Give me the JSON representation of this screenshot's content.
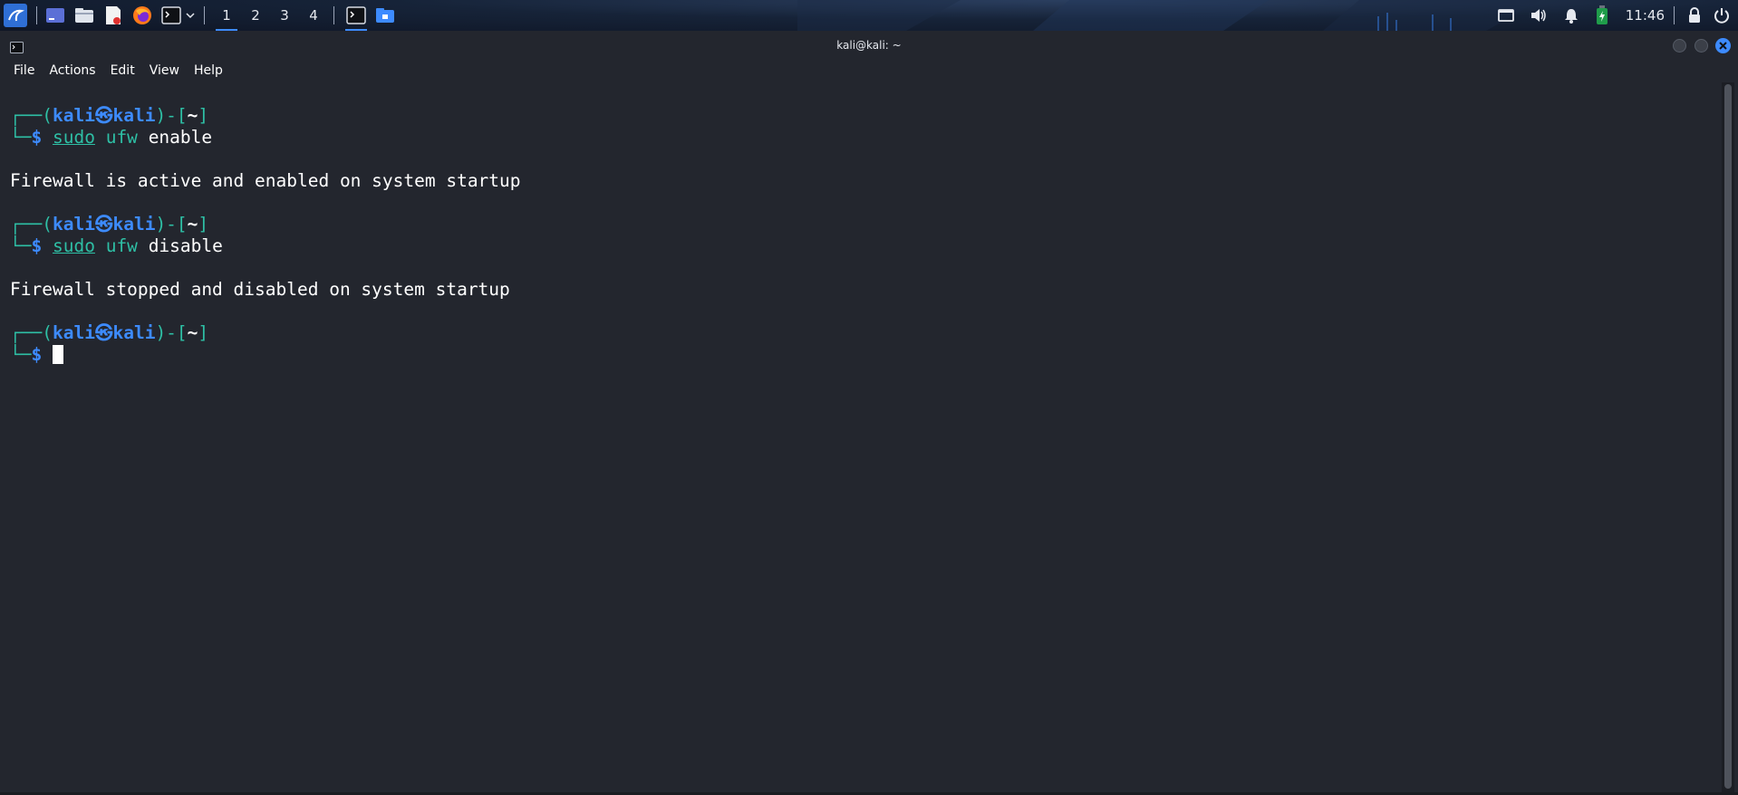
{
  "panel": {
    "workspaces": [
      "1",
      "2",
      "3",
      "4"
    ],
    "active_workspace": "1",
    "clock": "11:46",
    "icons": [
      "kali-menu-icon",
      "desktop-icon",
      "file-manager-icon",
      "text-editor-icon",
      "firefox-icon",
      "terminal-icon",
      "dropdown-icon",
      "terminal-task-icon",
      "file-manager-task-icon",
      "display-icon",
      "volume-icon",
      "notification-bell-icon",
      "battery-icon",
      "lock-icon",
      "power-icon"
    ]
  },
  "window": {
    "title": "kali@kali: ~",
    "menu": [
      "File",
      "Actions",
      "Edit",
      "View",
      "Help"
    ]
  },
  "terminal": {
    "prompt": {
      "corner_top": "┌──",
      "corner_bottom": "└─",
      "open": "(",
      "user": "kali",
      "at": "㉿",
      "host": "kali",
      "mid": ")-[",
      "cwd": "~",
      "close": "]",
      "dollar": "$"
    },
    "commands": [
      {
        "sudo": "sudo",
        "tool": "ufw",
        "arg": "enable"
      },
      {
        "sudo": "sudo",
        "tool": "ufw",
        "arg": "disable"
      }
    ],
    "outputs": [
      "Firewall is active and enabled on system startup",
      "Firewall stopped and disabled on system startup"
    ]
  },
  "colors": {
    "terminal_bg": "#23262e",
    "prompt_blue": "#3d8bff",
    "prompt_teal": "#2ebfa5",
    "text": "#ffffff"
  }
}
